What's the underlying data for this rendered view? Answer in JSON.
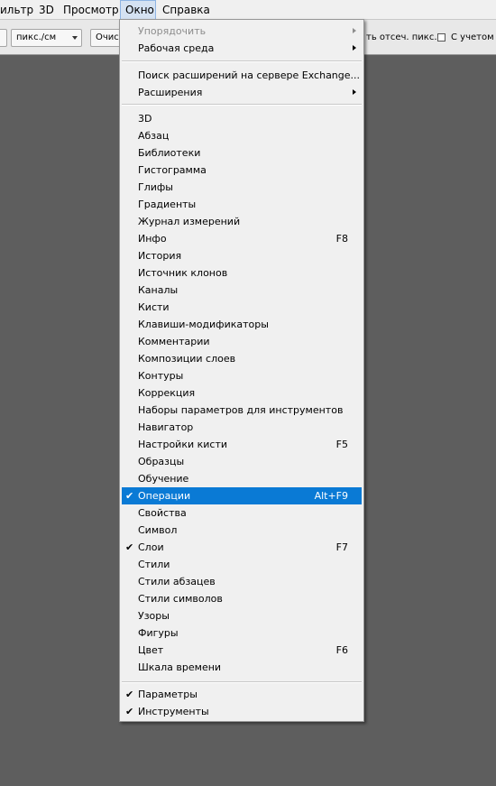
{
  "menubar": {
    "items": [
      {
        "label": "ильтр"
      },
      {
        "label": "3D"
      },
      {
        "label": "Просмотр"
      },
      {
        "label": "Окно"
      },
      {
        "label": "Справка"
      }
    ]
  },
  "options": {
    "units_value": "пикс./см",
    "clear_button": "Очис",
    "clip_pixels_label": "ть отсеч. пикс.",
    "with_label": "С учетом сл"
  },
  "menu": {
    "top_items": [
      {
        "label": "Упорядочить",
        "disabled": true,
        "submenu": true
      },
      {
        "label": "Рабочая среда",
        "submenu": true
      }
    ],
    "mid_items": [
      {
        "label": "Поиск расширений на сервере Exchange..."
      },
      {
        "label": "Расширения",
        "submenu": true
      }
    ],
    "panels": [
      {
        "label": "3D"
      },
      {
        "label": "Абзац"
      },
      {
        "label": "Библиотеки"
      },
      {
        "label": "Гистограмма"
      },
      {
        "label": "Глифы"
      },
      {
        "label": "Градиенты"
      },
      {
        "label": "Журнал измерений"
      },
      {
        "label": "Инфо",
        "shortcut": "F8"
      },
      {
        "label": "История"
      },
      {
        "label": "Источник клонов"
      },
      {
        "label": "Каналы"
      },
      {
        "label": "Кисти"
      },
      {
        "label": "Клавиши-модификаторы"
      },
      {
        "label": "Комментарии"
      },
      {
        "label": "Композиции слоев"
      },
      {
        "label": "Контуры"
      },
      {
        "label": "Коррекция"
      },
      {
        "label": "Наборы параметров для инструментов"
      },
      {
        "label": "Навигатор"
      },
      {
        "label": "Настройки кисти",
        "shortcut": "F5"
      },
      {
        "label": "Образцы"
      },
      {
        "label": "Обучение"
      },
      {
        "label": "Операции",
        "shortcut": "Alt+F9",
        "checked": true,
        "highlighted": true
      },
      {
        "label": "Свойства"
      },
      {
        "label": "Символ"
      },
      {
        "label": "Слои",
        "shortcut": "F7",
        "checked": true
      },
      {
        "label": "Стили"
      },
      {
        "label": "Стили абзацев"
      },
      {
        "label": "Стили символов"
      },
      {
        "label": "Узоры"
      },
      {
        "label": "Фигуры"
      },
      {
        "label": "Цвет",
        "shortcut": "F6"
      },
      {
        "label": "Шкала времени"
      }
    ],
    "bottom_items": [
      {
        "label": "Параметры",
        "checked": true
      },
      {
        "label": "Инструменты",
        "checked": true
      }
    ],
    "check_glyph": "✔"
  },
  "colors": {
    "highlight": "#0a7ad5",
    "menu_bg": "#f0f0f0",
    "workspace_bg": "#5e5e5e"
  }
}
